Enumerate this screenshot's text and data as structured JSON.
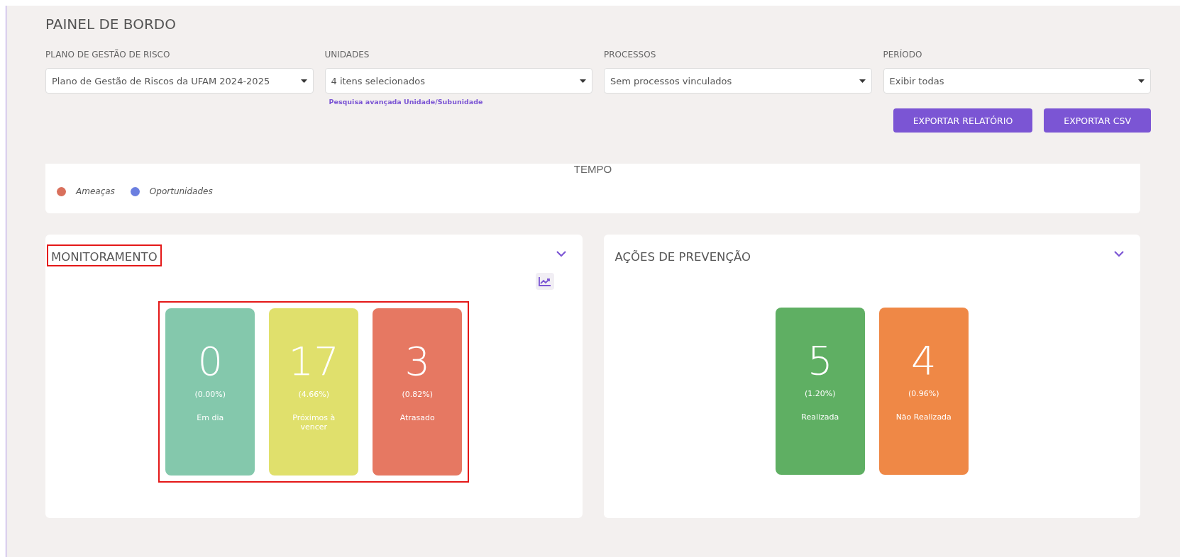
{
  "page_title": "PAINEL DE BORDO",
  "filters": [
    {
      "label": "PLANO DE GESTÃO DE RISCO",
      "value": "Plano de Gestão de Riscos da UFAM 2024-2025"
    },
    {
      "label": "UNIDADES",
      "value": "4 itens selecionados",
      "link": "Pesquisa avançada Unidade/Subunidade"
    },
    {
      "label": "PROCESSOS",
      "value": "Sem processos vinculados"
    },
    {
      "label": "PERÍODO",
      "value": "Exibir todas"
    }
  ],
  "buttons": [
    "EXPORTAR RELATÓRIO",
    "EXPORTAR CSV"
  ],
  "chart_panel": {
    "axis_title": "TEMPO",
    "legend": [
      {
        "label": "Ameaças",
        "color": "#d9705c"
      },
      {
        "label": "Oportunidades",
        "color": "#6b7fe0"
      }
    ]
  },
  "panels": [
    {
      "title": "MONITORAMENTO",
      "highlighted": true,
      "chart_button": true,
      "cards_highlighted": true,
      "cards": [
        {
          "value": "0",
          "percent": "(0.00%)",
          "label": "Em dia",
          "color": "#84c8ac"
        },
        {
          "value": "17",
          "percent": "(4.66%)",
          "label": "Próximos à vencer",
          "color": "#e0e06c"
        },
        {
          "value": "3",
          "percent": "(0.82%)",
          "label": "Atrasado",
          "color": "#e67862"
        }
      ]
    },
    {
      "title": "AÇÕES DE PREVENÇÃO",
      "highlighted": false,
      "cards_highlighted": false,
      "cards": [
        {
          "value": "5",
          "percent": "(1.20%)",
          "label": "Realizada",
          "color": "#5faf63"
        },
        {
          "value": "4",
          "percent": "(0.96%)",
          "label": "Não Realizada",
          "color": "#ef8846"
        }
      ]
    }
  ]
}
